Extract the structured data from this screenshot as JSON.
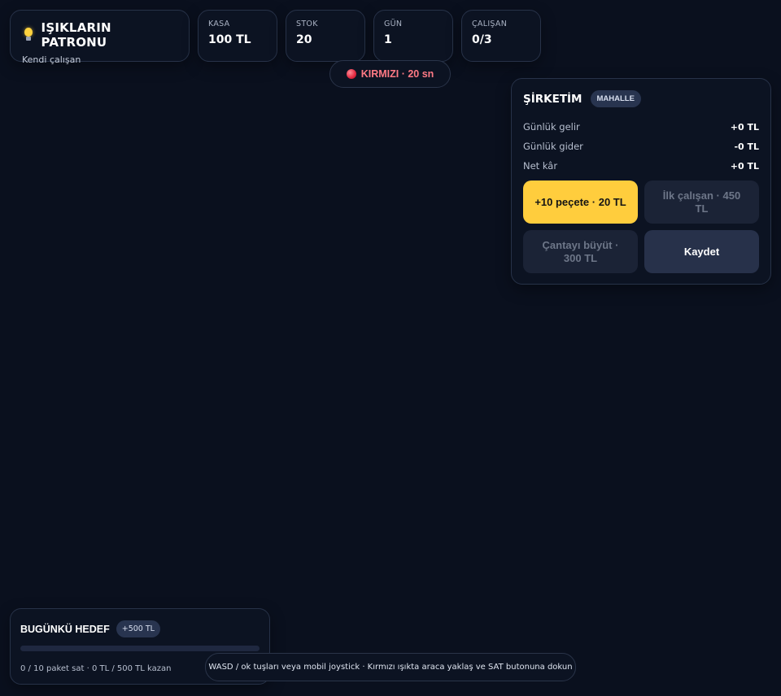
{
  "brand": {
    "title": "IŞIKLARIN PATRONU",
    "subtitle": "Kendi çalışan",
    "icon": "light-bulb-icon"
  },
  "stats": [
    {
      "label": "KASA",
      "value": "100 TL"
    },
    {
      "label": "STOK",
      "value": "20"
    },
    {
      "label": "GÜN",
      "value": "1"
    },
    {
      "label": "ÇALIŞAN",
      "value": "0/3"
    }
  ],
  "light": {
    "text": "KIRMIZI · 20 sn",
    "color": "#e0283f",
    "icon": "red-light-icon"
  },
  "company": {
    "title": "ŞİRKETİM",
    "badge": "MAHALLE",
    "rows": [
      {
        "label": "Günlük gelir",
        "value": "+0 TL"
      },
      {
        "label": "Günlük gider",
        "value": "-0 TL"
      },
      {
        "label": "Net kâr",
        "value": "+0 TL"
      }
    ],
    "buttons": {
      "buy_napkins": "+10 peçete · 20 TL",
      "first_employee": "İlk çalışan · 450 TL",
      "expand_bag": "Çantayı büyüt · 300 TL",
      "save": "Kaydet"
    }
  },
  "goal": {
    "title": "BUGÜNKÜ HEDEF",
    "reward": "+500 TL",
    "progress": 0,
    "text": "0 / 10 paket sat · 0 TL / 500 TL kazan"
  },
  "hint": "WASD / ok tuşları veya mobil joystick · Kırmızı ışıkta araca yaklaş ve SAT butonuna dokun",
  "colors": {
    "background": "#0a101e",
    "accent": "#ffcd3d",
    "danger": "#ff7a85"
  }
}
